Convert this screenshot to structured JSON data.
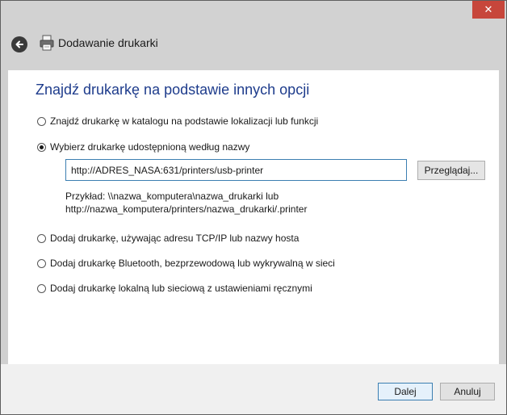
{
  "window": {
    "title": "Dodawanie drukarki",
    "close_glyph": "✕"
  },
  "icons": {
    "back": "back-arrow-icon",
    "printer": "printer-icon",
    "close": "close-icon"
  },
  "content": {
    "heading": "Znajdź drukarkę na podstawie innych opcji",
    "options": [
      {
        "label": "Znajdź drukarkę w katalogu na podstawie lokalizacji lub funkcji",
        "selected": false
      },
      {
        "label": "Wybierz drukarkę udostępnioną według nazwy",
        "selected": true
      },
      {
        "label": "Dodaj drukarkę, używając adresu TCP/IP lub nazwy hosta",
        "selected": false
      },
      {
        "label": "Dodaj drukarkę Bluetooth, bezprzewodową lub wykrywalną w sieci",
        "selected": false
      },
      {
        "label": "Dodaj drukarkę lokalną lub sieciową z ustawieniami ręcznymi",
        "selected": false
      }
    ],
    "printer_name_value": "http://ADRES_NASA:631/printers/usb-printer",
    "browse_label": "Przeglądaj...",
    "example_line1": "Przykład: \\\\nazwa_komputera\\nazwa_drukarki lub",
    "example_line2": "http://nazwa_komputera/printers/nazwa_drukarki/.printer"
  },
  "footer": {
    "next_label": "Dalej",
    "cancel_label": "Anuluj"
  },
  "colors": {
    "heading": "#1e3c8c",
    "close_button": "#c7463b",
    "focus_border": "#3c7fb1"
  }
}
